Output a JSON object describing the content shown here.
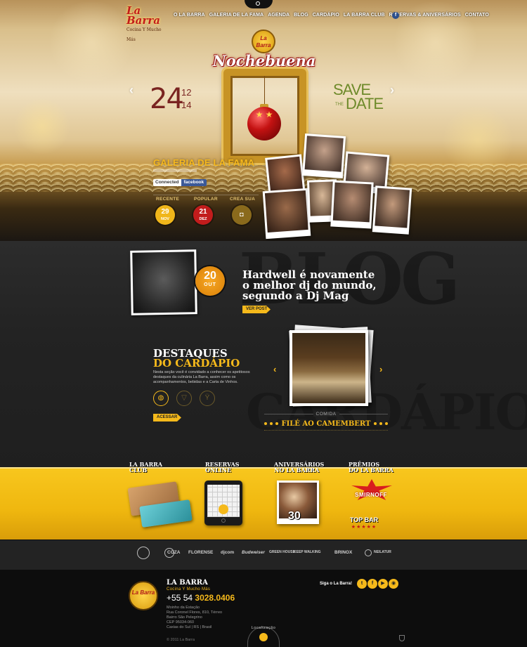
{
  "brand": {
    "name": "La Barra",
    "tagline": "Cocina Y Mucho Más",
    "accent": "#f5b91b",
    "red": "#c21c1c"
  },
  "nav": {
    "items": [
      "O LA BARRA",
      "GALERIA DE LA FAMA",
      "AGENDA",
      "BLOG",
      "CARDÁPIO",
      "LA BARRA CLUB",
      "RESERVAS & ANIVERSÁRIOS",
      "CONTATO"
    ],
    "search_icon": "search-icon",
    "facebook_label": "f"
  },
  "event": {
    "logo_text": "La Barra",
    "title": "Nochebuena",
    "day": "24",
    "month": "12",
    "year": "14",
    "save_line1": "SAVE",
    "save_the": "THE",
    "save_line2": "DATE",
    "prev_arrow": "‹",
    "next_arrow": "›"
  },
  "gallery": {
    "title": "GALERIA DE LA FAMA",
    "connected_label": "Connected",
    "facebook_label": "facebook",
    "tabs": [
      {
        "label": "RECENTE",
        "day": "29",
        "month": "NOV",
        "color": "#f0b61a"
      },
      {
        "label": "POPULAR",
        "day": "21",
        "month": "DEZ",
        "color": "#c21c1c"
      },
      {
        "label": "CREA SUA",
        "icon": "camera-icon",
        "color": "#8a6a1c"
      }
    ]
  },
  "blog": {
    "bg_word": "BLOG",
    "date_day": "20",
    "date_month": "OUT",
    "title": "Hardwell é novamente o melhor dj do mundo, segundo a Dj Mag",
    "button": "VER POST"
  },
  "menu": {
    "bg_word": "CARDÁPIO",
    "title_line1": "DESTAQUES",
    "title_line2": "DO CARDÁPIO",
    "description": "Nesta seção você é convidado a conhecer os apetitosos destaques da culinária La Barra, assim como os acompanhamentos, bebidas e a Carta de Vinhos.",
    "icons": [
      "plate-icon",
      "drink-icon",
      "wine-icon"
    ],
    "button": "ACESSAR",
    "dish_category": "COMIDA",
    "dish_name": "FILÉ AO CAMEMBERT",
    "prev_arrow": "‹",
    "next_arrow": "›"
  },
  "promos": [
    {
      "line1": "LA BARRA",
      "line2": "CLUB"
    },
    {
      "line1": "RESERVAS",
      "line2": "ONLINE"
    },
    {
      "line1": "ANIVERSÁRIOS",
      "line2": "NO LA BARRA"
    },
    {
      "line1": "PRÊMIOS",
      "line2": "DO LA BARRA"
    }
  ],
  "aniv_number": "30",
  "award": {
    "brand": "SMIRNOFF",
    "title": "TOP BAR",
    "stars": "★★★★★"
  },
  "partners": [
    "COZA",
    "FLORENSE",
    "djcom",
    "Budweiser",
    "GREEN HOUSE",
    "KEEP WALKING",
    "BRINOX",
    "NEILATUR"
  ],
  "footer": {
    "name": "LA BARRA",
    "slogan": "Cocina Y Mucho Más",
    "phone_prefix": "+55 54",
    "phone_number": "3028.0406",
    "address": [
      "Moinho da Estação",
      "Rua Coronel Flores, 810, Térreo",
      "Bairro São Pelegrino",
      "CEP 95034-060",
      "Caxias do Sul | RS | Brasil"
    ],
    "copyright": "© 2011 La Barra",
    "follow": "Siga o La Barra!",
    "social": [
      "t",
      "f",
      "▶",
      "◉"
    ],
    "location": "Localização"
  }
}
